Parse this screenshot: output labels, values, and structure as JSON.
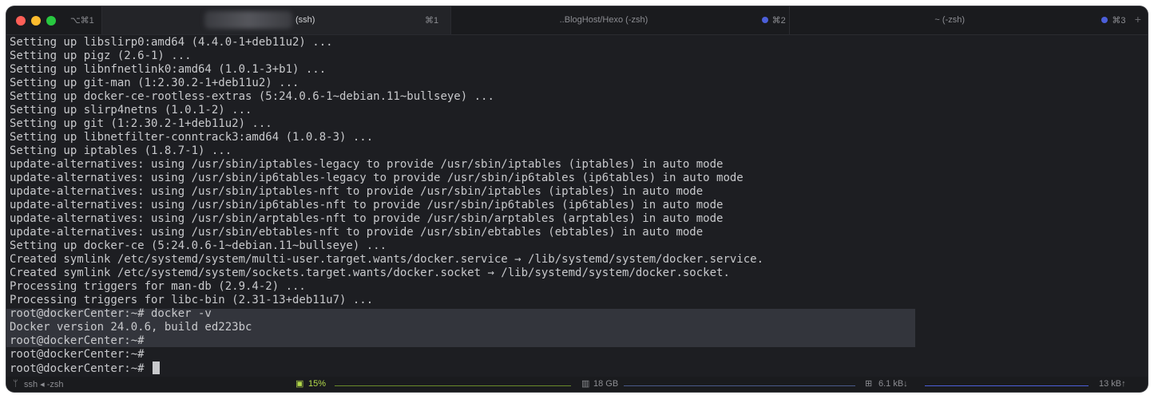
{
  "window": {
    "traffic_shortcut": "⌥⌘1",
    "tabs": [
      {
        "label": "(ssh)",
        "shortcut": "⌘1"
      },
      {
        "label": "..BlogHost/Hexo (-zsh)",
        "shortcut": "⌘2"
      },
      {
        "label": "~ (-zsh)",
        "shortcut": "⌘3"
      }
    ],
    "new_tab": "+"
  },
  "terminal": {
    "lines": [
      "Setting up libslirp0:amd64 (4.4.0-1+deb11u2) ...",
      "Setting up pigz (2.6-1) ...",
      "Setting up libnfnetlink0:amd64 (1.0.1-3+b1) ...",
      "Setting up git-man (1:2.30.2-1+deb11u2) ...",
      "Setting up docker-ce-rootless-extras (5:24.0.6-1~debian.11~bullseye) ...",
      "Setting up slirp4netns (1.0.1-2) ...",
      "Setting up git (1:2.30.2-1+deb11u2) ...",
      "Setting up libnetfilter-conntrack3:amd64 (1.0.8-3) ...",
      "Setting up iptables (1.8.7-1) ...",
      "update-alternatives: using /usr/sbin/iptables-legacy to provide /usr/sbin/iptables (iptables) in auto mode",
      "update-alternatives: using /usr/sbin/ip6tables-legacy to provide /usr/sbin/ip6tables (ip6tables) in auto mode",
      "update-alternatives: using /usr/sbin/iptables-nft to provide /usr/sbin/iptables (iptables) in auto mode",
      "update-alternatives: using /usr/sbin/ip6tables-nft to provide /usr/sbin/ip6tables (ip6tables) in auto mode",
      "update-alternatives: using /usr/sbin/arptables-nft to provide /usr/sbin/arptables (arptables) in auto mode",
      "update-alternatives: using /usr/sbin/ebtables-nft to provide /usr/sbin/ebtables (ebtables) in auto mode",
      "Setting up docker-ce (5:24.0.6-1~debian.11~bullseye) ...",
      "Created symlink /etc/systemd/system/multi-user.target.wants/docker.service → /lib/systemd/system/docker.service.",
      "Created symlink /etc/systemd/system/sockets.target.wants/docker.socket → /lib/systemd/system/docker.socket.",
      "Processing triggers for man-db (2.9.4-2) ...",
      "Processing triggers for libc-bin (2.31-13+deb11u7) ...",
      "root@dockerCenter:~# docker -v",
      "Docker version 24.0.6, build ed223bc",
      "root@dockerCenter:~#",
      "root@dockerCenter:~#",
      "root@dockerCenter:~# "
    ]
  },
  "status_bar": {
    "session": "ssh ◂ -zsh",
    "cpu": "15%",
    "memory": "18 GB",
    "net_down": "6.1 kB↓",
    "net_up": "13 kB↑"
  },
  "colors": {
    "accent_dot": "#4c5fd9",
    "cpu_green": "#b3d94a",
    "highlight": "#33353c"
  }
}
